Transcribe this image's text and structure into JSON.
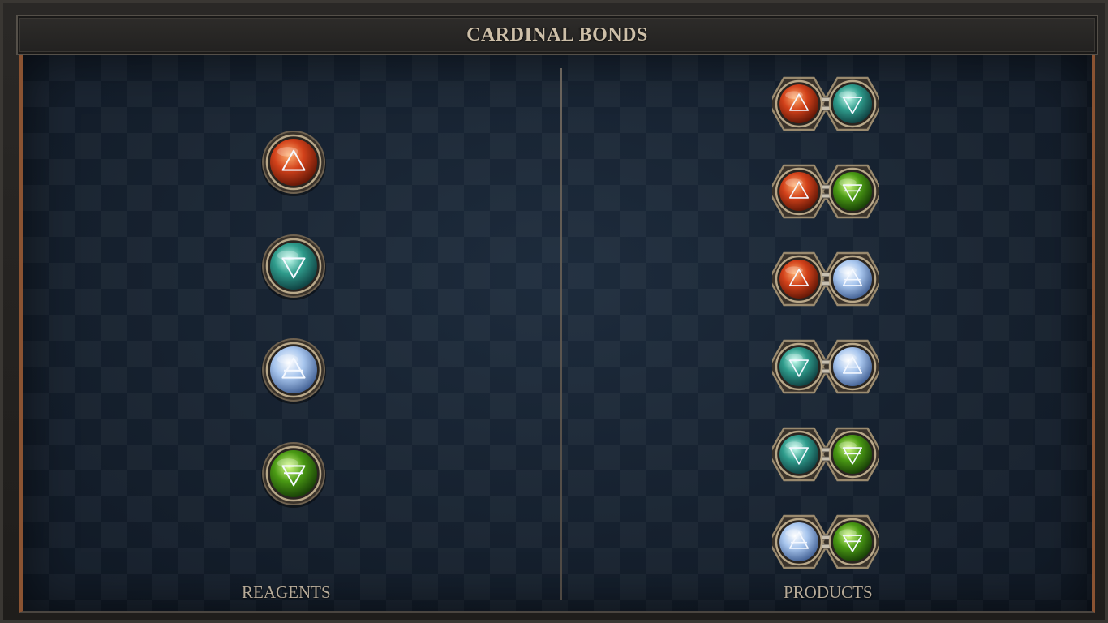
{
  "header": {
    "title": "CARDINAL BONDS"
  },
  "columns": {
    "left_label": "REAGENTS",
    "right_label": "PRODUCTS"
  },
  "colors": {
    "fire": [
      "#ffb070",
      "#d2411a",
      "#5a1405"
    ],
    "water": [
      "#c8fff0",
      "#2f9c8c",
      "#0d3a3c"
    ],
    "air": [
      "#ffffff",
      "#a8c6ee",
      "#3c5a8e"
    ],
    "earth": [
      "#d8ff8a",
      "#4a9a14",
      "#143806"
    ],
    "rim": "#8a7a62",
    "panel_border": "#8a5332"
  },
  "elements": {
    "fire": {
      "symbol": "fire-triangle-icon"
    },
    "water": {
      "symbol": "water-triangle-icon"
    },
    "air": {
      "symbol": "air-triangle-icon"
    },
    "earth": {
      "symbol": "earth-triangle-icon"
    }
  },
  "reagents": [
    "fire",
    "water",
    "air",
    "earth"
  ],
  "products": [
    [
      "fire",
      "water"
    ],
    [
      "fire",
      "earth"
    ],
    [
      "fire",
      "air"
    ],
    [
      "water",
      "air"
    ],
    [
      "water",
      "earth"
    ],
    [
      "air",
      "earth"
    ]
  ]
}
